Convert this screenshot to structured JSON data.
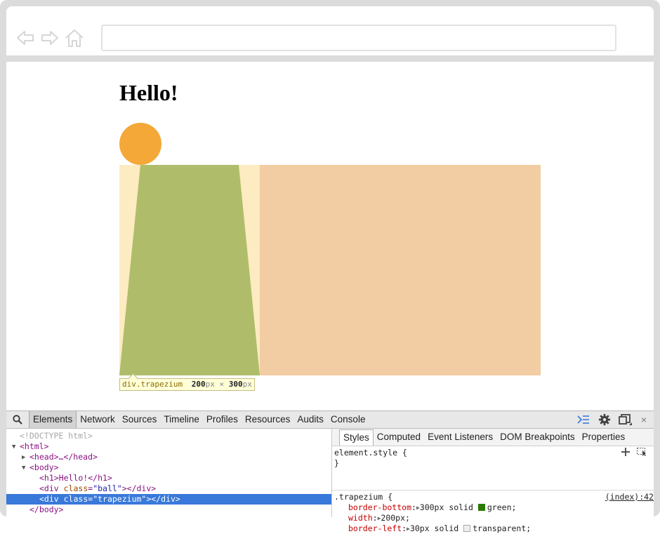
{
  "browser": {
    "back_icon": "back-arrow-icon",
    "forward_icon": "forward-arrow-icon",
    "home_icon": "home-icon",
    "url_value": ""
  },
  "page": {
    "heading": "Hello!",
    "ball_color": "#f4a838",
    "trapezium_color": "#afbd6b",
    "tooltip": {
      "selector": "div.trapezium",
      "width": "200",
      "unit": "px",
      "times": "×",
      "height": "300"
    }
  },
  "devtools": {
    "search_icon": "search-icon",
    "tabs": [
      "Elements",
      "Network",
      "Sources",
      "Timeline",
      "Profiles",
      "Resources",
      "Audits",
      "Console"
    ],
    "right_icons": [
      "console-drawer-icon",
      "gear-icon",
      "dock-icon",
      "close-icon"
    ],
    "close_glyph": "×",
    "dom": {
      "doctype": "<!DOCTYPE html>",
      "html_open": "<html>",
      "head_collapsed": "<head>…</head>",
      "body_open": "<body>",
      "h1": "<h1>Hello!</h1>",
      "ball_div_open": "<div ",
      "ball_attr_name": "class",
      "ball_attr_value": "\"ball\"",
      "ball_div_close": "></div>",
      "trap_div_open": "<div ",
      "trap_attr_name": "class",
      "trap_attr_value": "\"trapezium\"",
      "trap_div_close": "></div>",
      "body_close": "</body>",
      "eq": "="
    },
    "styles": {
      "tabs": [
        "Styles",
        "Computed",
        "Event Listeners",
        "DOM Breakpoints",
        "Properties"
      ],
      "element_style_open": "element.style {",
      "element_style_close": "}",
      "add_icon": "plus-icon",
      "toggle_icon": "element-state-icon",
      "rule_selector": ".trapezium {",
      "rule_source": "(index):42",
      "declarations": [
        {
          "name": "border-bottom",
          "value": "300px solid ",
          "keyword": "green;",
          "swatch": "#2a7a00"
        },
        {
          "name": "width",
          "value": "200px;",
          "keyword": "",
          "swatch": ""
        },
        {
          "name": "border-left",
          "value": "30px solid ",
          "keyword": "transparent;",
          "swatch": "transparent"
        }
      ],
      "colon": ":"
    }
  }
}
